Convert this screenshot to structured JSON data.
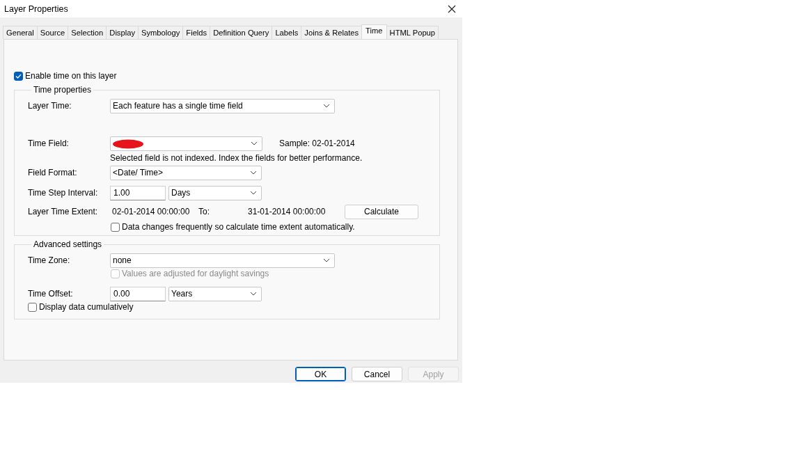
{
  "window": {
    "title": "Layer Properties"
  },
  "tabs": [
    {
      "label": "General",
      "selected": false
    },
    {
      "label": "Source",
      "selected": false
    },
    {
      "label": "Selection",
      "selected": false
    },
    {
      "label": "Display",
      "selected": false
    },
    {
      "label": "Symbology",
      "selected": false
    },
    {
      "label": "Fields",
      "selected": false
    },
    {
      "label": "Definition Query",
      "selected": false
    },
    {
      "label": "Labels",
      "selected": false
    },
    {
      "label": "Joins & Relates",
      "selected": false
    },
    {
      "label": "Time",
      "selected": true
    },
    {
      "label": "HTML Popup",
      "selected": false
    }
  ],
  "enable_time": {
    "label": "Enable time on this layer",
    "checked": true,
    "disabled": false
  },
  "time_properties": {
    "title": "Time properties",
    "layer_time": {
      "label": "Layer Time:",
      "value": "Each feature has a single time field"
    },
    "time_field": {
      "label": "Time Field:",
      "redacted": true,
      "sample": "Sample: 02-01-2014",
      "note": "Selected field is not indexed. Index the fields for better performance."
    },
    "field_format": {
      "label": "Field Format:",
      "value": "<Date/ Time>"
    },
    "time_step": {
      "label": "Time Step Interval:",
      "value": "1.00",
      "unit": "Days"
    },
    "extent": {
      "label": "Layer Time Extent:",
      "start": "02-01-2014 00:00:00",
      "to_label": "To:",
      "end": "31-01-2014 00:00:00",
      "button": "Calculate"
    },
    "auto_extent": {
      "label": "Data changes frequently so calculate time extent automatically.",
      "checked": false,
      "disabled": false
    }
  },
  "advanced": {
    "title": "Advanced settings",
    "time_zone": {
      "label": "Time Zone:",
      "value": "none"
    },
    "daylight": {
      "label": "Values are adjusted for daylight savings",
      "checked": false,
      "disabled": true
    },
    "time_offset": {
      "label": "Time Offset:",
      "value": "0.00",
      "unit": "Years"
    },
    "cumulative": {
      "label": "Display data cumulatively",
      "checked": false,
      "disabled": false
    }
  },
  "buttons": [
    {
      "label": "OK",
      "kind": "default",
      "disabled": false
    },
    {
      "label": "Cancel",
      "kind": "normal",
      "disabled": false
    },
    {
      "label": "Apply",
      "kind": "normal",
      "disabled": true
    }
  ]
}
